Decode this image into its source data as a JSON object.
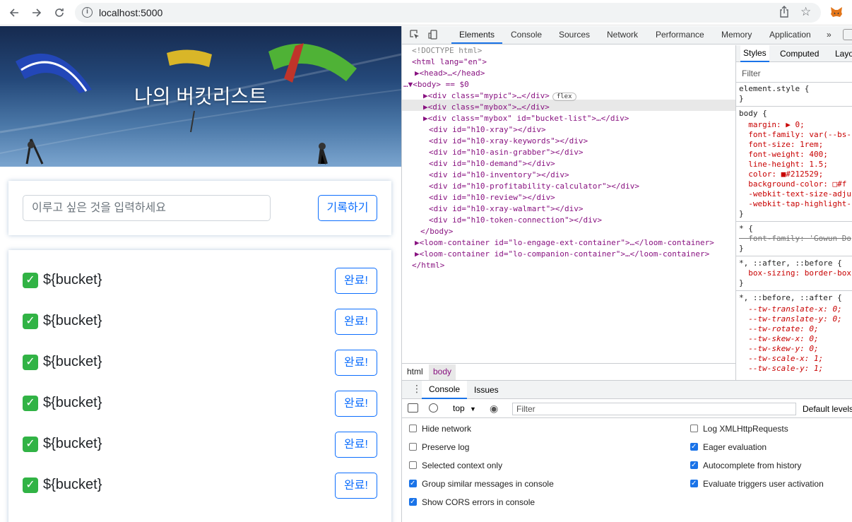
{
  "browser": {
    "url": "localhost:5000"
  },
  "page": {
    "hero_title": "나의 버킷리스트",
    "input_placeholder": "이루고 싶은 것을 입력하세요",
    "record_button": "기록하기",
    "check_glyph": "✓",
    "buckets": [
      {
        "text": "${bucket}",
        "button": "완료!"
      },
      {
        "text": "${bucket}",
        "button": "완료!"
      },
      {
        "text": "${bucket}",
        "button": "완료!"
      },
      {
        "text": "${bucket}",
        "button": "완료!"
      },
      {
        "text": "${bucket}",
        "button": "완료!"
      },
      {
        "text": "${bucket}",
        "button": "완료!"
      }
    ]
  },
  "devtools": {
    "tabs": [
      "Elements",
      "Console",
      "Sources",
      "Network",
      "Performance",
      "Memory",
      "Application",
      "»"
    ],
    "active_tab": "Elements",
    "dom_lines": [
      "<!DOCTYPE html>",
      "<html lang=\"en\">",
      "▶<head>…</head>",
      "…▼<body> == $0",
      "▶<div class=\"mypic\">…</div>",
      "▶<div class=\"mybox\">…</div>",
      "▶<div class=\"mybox\" id=\"bucket-list\">…</div>",
      "<div id=\"h10-xray\"></div>",
      "<div id=\"h10-xray-keywords\"></div>",
      "<div id=\"h10-asin-grabber\"></div>",
      "<div id=\"h10-demand\"></div>",
      "<div id=\"h10-inventory\"></div>",
      "<div id=\"h10-profitability-calculator\"></div>",
      "<div id=\"h10-review\"></div>",
      "<div id=\"h10-xray-walmart\"></div>",
      "<div id=\"h10-token-connection\"></div>",
      "</body>",
      "▶<loom-container id=\"lo-engage-ext-container\">…</loom-container>",
      "▶<loom-container id=\"lo-companion-container\">…</loom-container>",
      "</html>"
    ],
    "flex_badge": "flex",
    "breadcrumbs": [
      "html",
      "body"
    ],
    "styles_tabs": [
      "Styles",
      "Computed",
      "Layo"
    ],
    "styles_filter": "Filter",
    "styles_lines": [
      "element.style {",
      "}",
      "body {",
      "  margin: ▶ 0;",
      "  font-family: var(--bs-",
      "  font-size: 1rem;",
      "  font-weight: 400;",
      "  line-height: 1.5;",
      "  color: ■#212529;",
      "  background-color: □#f",
      "  -webkit-text-size-adju",
      "  -webkit-tap-highlight-",
      "}",
      "* {",
      "  font-family: 'Gowun Do",
      "}",
      "*, ::after, ::before {",
      "  box-sizing: border-box",
      "}",
      "*, ::before, ::after {",
      "  --tw-translate-x: 0;",
      "  --tw-translate-y: 0;",
      "  --tw-rotate: 0;",
      "  --tw-skew-x: 0;",
      "  --tw-skew-y: 0;",
      "  --tw-scale-x: 1;",
      "  --tw-scale-y: 1;"
    ],
    "drawer_tabs": [
      "Console",
      "Issues"
    ],
    "context": "top",
    "console_filter": "Filter",
    "default_levels": "Default levels",
    "options_left": [
      {
        "label": "Hide network",
        "checked": false
      },
      {
        "label": "Preserve log",
        "checked": false
      },
      {
        "label": "Selected context only",
        "checked": false
      },
      {
        "label": "Group similar messages in console",
        "checked": true
      },
      {
        "label": "Show CORS errors in console",
        "checked": true
      }
    ],
    "options_right": [
      {
        "label": "Log XMLHttpRequests",
        "checked": false
      },
      {
        "label": "Eager evaluation",
        "checked": true
      },
      {
        "label": "Autocomplete from history",
        "checked": true
      },
      {
        "label": "Evaluate triggers user activation",
        "checked": true
      }
    ]
  },
  "colors": {
    "accent": "#0d6efd",
    "check": "#31b345",
    "devtools_active": "#1a73e8"
  }
}
